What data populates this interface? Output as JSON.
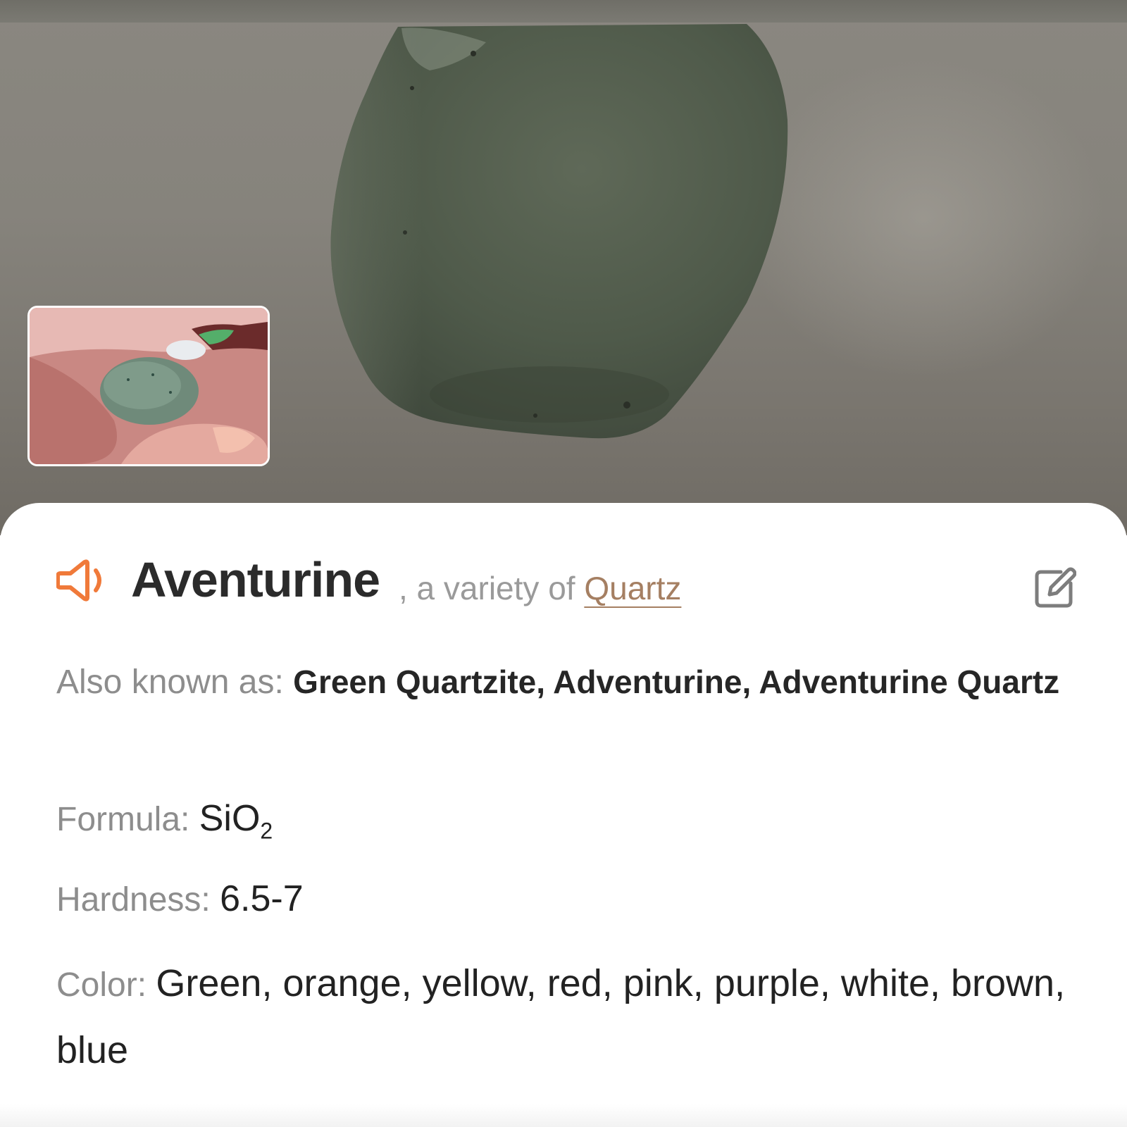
{
  "mineral": {
    "name": "Aventurine",
    "connector": ", a variety of ",
    "parent": "Quartz"
  },
  "fields": {
    "aka_label": "Also known as: ",
    "aka_value": "Green Quartzite, Adventurine, Adventurine Quartz",
    "formula_label": "Formula: ",
    "formula_value": "SiO",
    "formula_subscript": "2",
    "hardness_label": "Hardness: ",
    "hardness_value": "6.5-7",
    "color_label": "Color: ",
    "color_value": "Green, orange, yellow, red, pink, purple, white, brown, blue"
  },
  "icons": {
    "speaker": "speaker-icon",
    "edit": "edit-icon"
  },
  "colors": {
    "accent_orange": "#f07a3a",
    "link_brown": "#a57f62",
    "label_gray": "#8d8d8d",
    "text_dark": "#222222"
  }
}
